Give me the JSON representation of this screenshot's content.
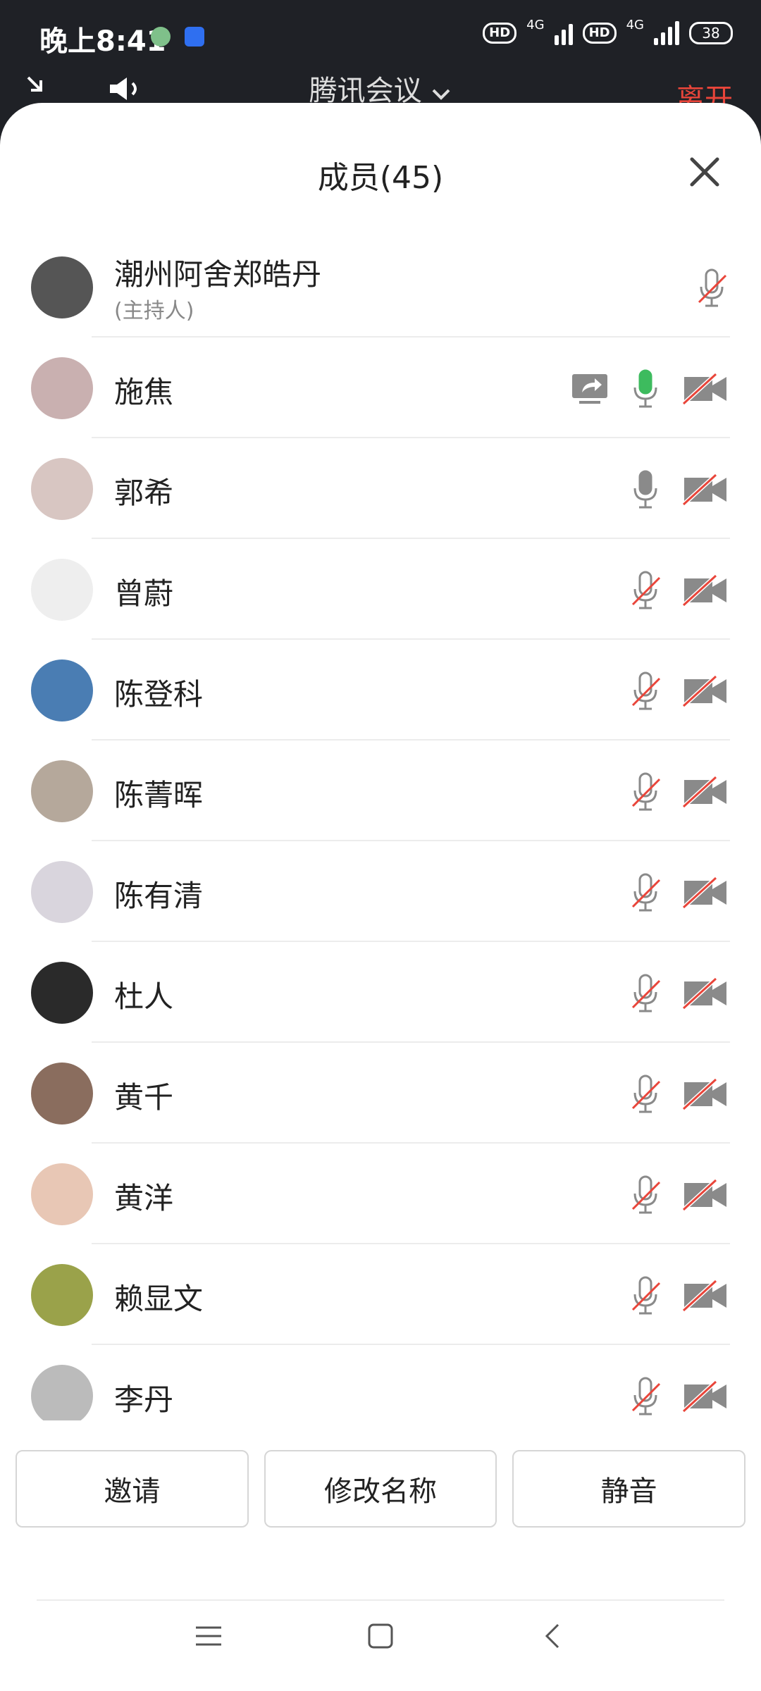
{
  "status_bar": {
    "time": "晚上8:41",
    "network_1": "4G",
    "network_2": "4G",
    "hd_1": "HD",
    "hd_2": "HD",
    "battery": "38"
  },
  "meeting": {
    "title": "腾讯会议",
    "leave_label": "离开"
  },
  "panel": {
    "title": "成员(45)"
  },
  "members": [
    {
      "name": "潮州阿舍郑皓丹",
      "role": "(主持人)",
      "share": false,
      "mic": "muted",
      "camera": "none"
    },
    {
      "name": "施焦",
      "role": "",
      "share": true,
      "mic": "active",
      "camera": "off"
    },
    {
      "name": "郭希",
      "role": "",
      "share": false,
      "mic": "on",
      "camera": "off"
    },
    {
      "name": "曾蔚",
      "role": "",
      "share": false,
      "mic": "muted",
      "camera": "off"
    },
    {
      "name": "陈登科",
      "role": "",
      "share": false,
      "mic": "muted",
      "camera": "off"
    },
    {
      "name": "陈菁晖",
      "role": "",
      "share": false,
      "mic": "muted",
      "camera": "off"
    },
    {
      "name": "陈有清",
      "role": "",
      "share": false,
      "mic": "muted",
      "camera": "off"
    },
    {
      "name": "杜人",
      "role": "",
      "share": false,
      "mic": "muted",
      "camera": "off"
    },
    {
      "name": "黄千",
      "role": "",
      "share": false,
      "mic": "muted",
      "camera": "off"
    },
    {
      "name": "黄洋",
      "role": "",
      "share": false,
      "mic": "muted",
      "camera": "off"
    },
    {
      "name": "赖显文",
      "role": "",
      "share": false,
      "mic": "muted",
      "camera": "off"
    },
    {
      "name": "李丹",
      "role": "",
      "share": false,
      "mic": "muted",
      "camera": "off"
    }
  ],
  "actions": {
    "invite": "邀请",
    "rename": "修改名称",
    "mute_all": "静音"
  },
  "colors": {
    "muted_slash": "#e9453a",
    "mic_active": "#3dbb5e",
    "icon_gray": "#8a8a8a",
    "leave": "#e9453a"
  }
}
